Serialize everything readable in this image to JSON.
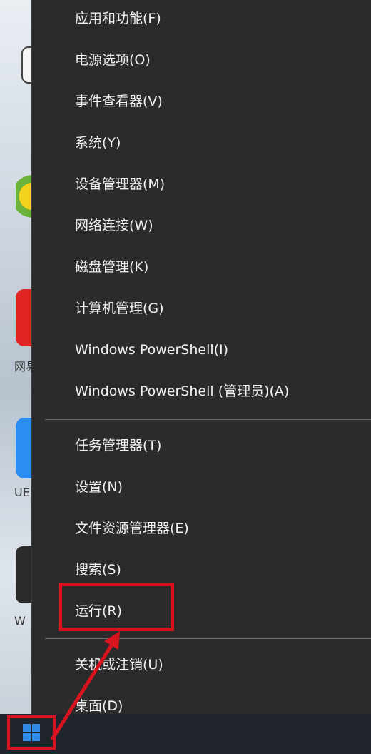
{
  "menu": {
    "group1": [
      {
        "label": "应用和功能(F)"
      },
      {
        "label": "电源选项(O)"
      },
      {
        "label": "事件查看器(V)"
      },
      {
        "label": "系统(Y)"
      },
      {
        "label": "设备管理器(M)"
      },
      {
        "label": "网络连接(W)"
      },
      {
        "label": "磁盘管理(K)"
      },
      {
        "label": "计算机管理(G)"
      },
      {
        "label": "Windows PowerShell(I)"
      },
      {
        "label": "Windows PowerShell (管理员)(A)"
      }
    ],
    "group2": [
      {
        "label": "任务管理器(T)"
      },
      {
        "label": "设置(N)"
      },
      {
        "label": "文件资源管理器(E)"
      },
      {
        "label": "搜索(S)"
      },
      {
        "label": "运行(R)"
      }
    ],
    "group3": [
      {
        "label": "关机或注销(U)"
      },
      {
        "label": "桌面(D)"
      }
    ]
  },
  "desktop": {
    "labels": [
      "网易",
      "UE",
      "W"
    ]
  },
  "colors": {
    "menu_bg": "#2b2b2b",
    "menu_text": "#f2f2f2",
    "annotation": "#d9141e",
    "win_blue": "#2f8be6"
  }
}
